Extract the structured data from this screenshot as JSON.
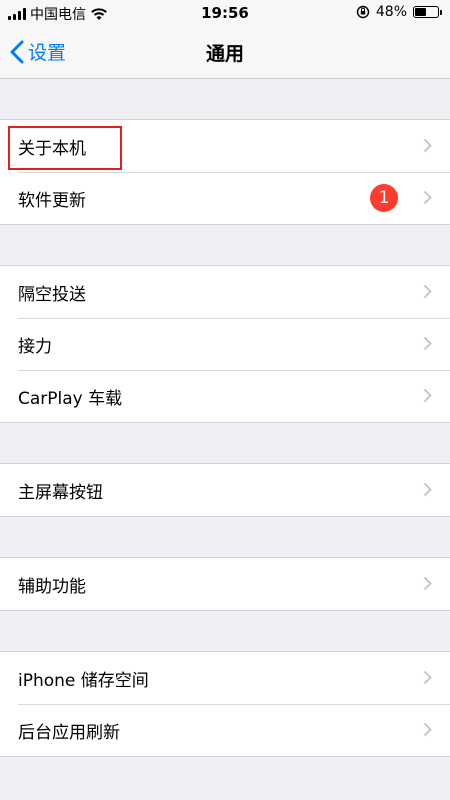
{
  "status_bar": {
    "carrier": "中国电信",
    "time": "19:56",
    "battery_text": "48%",
    "battery_level": 0.48
  },
  "nav": {
    "back_label": "设置",
    "title": "通用"
  },
  "groups": [
    {
      "items": [
        {
          "label": "关于本机",
          "highlighted": true
        },
        {
          "label": "软件更新",
          "badge": "1"
        }
      ]
    },
    {
      "items": [
        {
          "label": "隔空投送"
        },
        {
          "label": "接力"
        },
        {
          "label": "CarPlay 车载"
        }
      ]
    },
    {
      "items": [
        {
          "label": "主屏幕按钮"
        }
      ]
    },
    {
      "items": [
        {
          "label": "辅助功能"
        }
      ]
    },
    {
      "items": [
        {
          "label": "iPhone 储存空间"
        },
        {
          "label": "后台应用刷新"
        }
      ]
    }
  ],
  "colors": {
    "accent": "#007aff",
    "badge": "#ff3b30",
    "highlight": "#e02020",
    "background": "#efeff4"
  }
}
